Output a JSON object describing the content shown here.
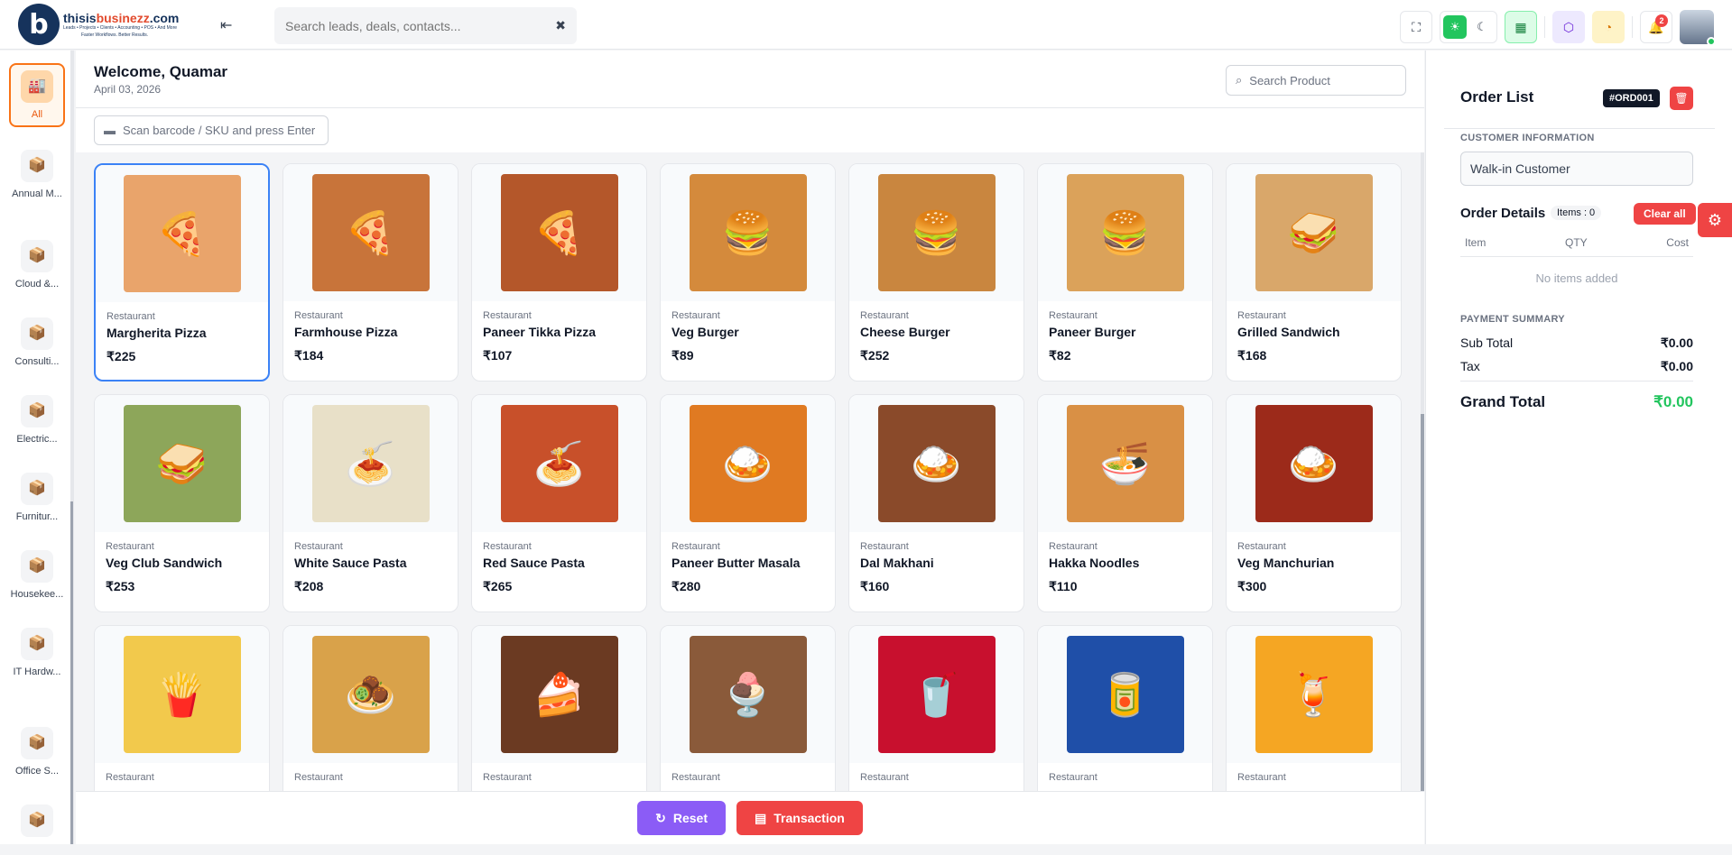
{
  "brand": {
    "name_a": "thisis",
    "name_b": "businezz",
    "name_c": ".com",
    "sub": "Leads • Projects • Clients • Accounting • POS • And More",
    "tagline": "Faster Workflows. Better Results."
  },
  "header": {
    "search_placeholder": "Search leads, deals, contacts...",
    "notification_count": "2"
  },
  "categories": [
    {
      "label": "All"
    },
    {
      "label": "Annual M..."
    },
    {
      "label": "Cloud &..."
    },
    {
      "label": "Consulti..."
    },
    {
      "label": "Electric..."
    },
    {
      "label": "Furnitur..."
    },
    {
      "label": "Housekee..."
    },
    {
      "label": "IT Hardw..."
    },
    {
      "label": "Office S..."
    },
    {
      "label": ""
    }
  ],
  "main": {
    "welcome": "Welcome, Quamar",
    "date": "April 03, 2026",
    "product_search_placeholder": "Search Product",
    "scan_placeholder": "Scan barcode / SKU and press Enter"
  },
  "products": [
    {
      "category": "Restaurant",
      "name": "Margherita Pizza",
      "price": "₹225",
      "icon": "pizza",
      "color": "#e9a46b"
    },
    {
      "category": "Restaurant",
      "name": "Farmhouse Pizza",
      "price": "₹184",
      "icon": "pizza",
      "color": "#c8743a"
    },
    {
      "category": "Restaurant",
      "name": "Paneer Tikka Pizza",
      "price": "₹107",
      "icon": "pizza",
      "color": "#b4572a"
    },
    {
      "category": "Restaurant",
      "name": "Veg Burger",
      "price": "₹89",
      "icon": "burger",
      "color": "#d48a3c"
    },
    {
      "category": "Restaurant",
      "name": "Cheese Burger",
      "price": "₹252",
      "icon": "burger",
      "color": "#c9863f"
    },
    {
      "category": "Restaurant",
      "name": "Paneer Burger",
      "price": "₹82",
      "icon": "burger",
      "color": "#dba25a"
    },
    {
      "category": "Restaurant",
      "name": "Grilled Sandwich",
      "price": "₹168",
      "icon": "sandwich",
      "color": "#d9a76a"
    },
    {
      "category": "Restaurant",
      "name": "Veg Club Sandwich",
      "price": "₹253",
      "icon": "sandwich",
      "color": "#8da65a"
    },
    {
      "category": "Restaurant",
      "name": "White Sauce Pasta",
      "price": "₹208",
      "icon": "pasta",
      "color": "#e8e0c8"
    },
    {
      "category": "Restaurant",
      "name": "Red Sauce Pasta",
      "price": "₹265",
      "icon": "pasta",
      "color": "#c8502a"
    },
    {
      "category": "Restaurant",
      "name": "Paneer Butter Masala",
      "price": "₹280",
      "icon": "curry",
      "color": "#e07a22"
    },
    {
      "category": "Restaurant",
      "name": "Dal Makhani",
      "price": "₹160",
      "icon": "curry",
      "color": "#8a4a2a"
    },
    {
      "category": "Restaurant",
      "name": "Hakka Noodles",
      "price": "₹110",
      "icon": "noodles",
      "color": "#d99045"
    },
    {
      "category": "Restaurant",
      "name": "Veg Manchurian",
      "price": "₹300",
      "icon": "curry",
      "color": "#9c2a1a"
    },
    {
      "category": "Restaurant",
      "name": "",
      "price": "",
      "icon": "fries",
      "color": "#f2c94c"
    },
    {
      "category": "Restaurant",
      "name": "",
      "price": "",
      "icon": "snack",
      "color": "#d9a24a"
    },
    {
      "category": "Restaurant",
      "name": "",
      "price": "",
      "icon": "cake",
      "color": "#6b3a22"
    },
    {
      "category": "Restaurant",
      "name": "",
      "price": "",
      "icon": "icecream",
      "color": "#8a5a3a"
    },
    {
      "category": "Restaurant",
      "name": "",
      "price": "",
      "icon": "cola",
      "color": "#c8102e"
    },
    {
      "category": "Restaurant",
      "name": "",
      "price": "",
      "icon": "pepsi",
      "color": "#1f4fa8"
    },
    {
      "category": "Restaurant",
      "name": "",
      "price": "",
      "icon": "juice",
      "color": "#f5a623"
    }
  ],
  "footer": {
    "reset_label": "Reset",
    "transaction_label": "Transaction"
  },
  "order": {
    "title": "Order List",
    "id": "#ORD001",
    "customer_label": "CUSTOMER INFORMATION",
    "customer_value": "Walk-in Customer",
    "details_title": "Order Details",
    "items_count": "Items : 0",
    "clear_all": "Clear all",
    "col_item": "Item",
    "col_qty": "QTY",
    "col_cost": "Cost",
    "empty": "No items added",
    "payment_label": "PAYMENT SUMMARY",
    "subtotal_label": "Sub Total",
    "subtotal_value": "₹0.00",
    "tax_label": "Tax",
    "tax_value": "₹0.00",
    "grand_label": "Grand Total",
    "grand_value": "₹0.00"
  }
}
